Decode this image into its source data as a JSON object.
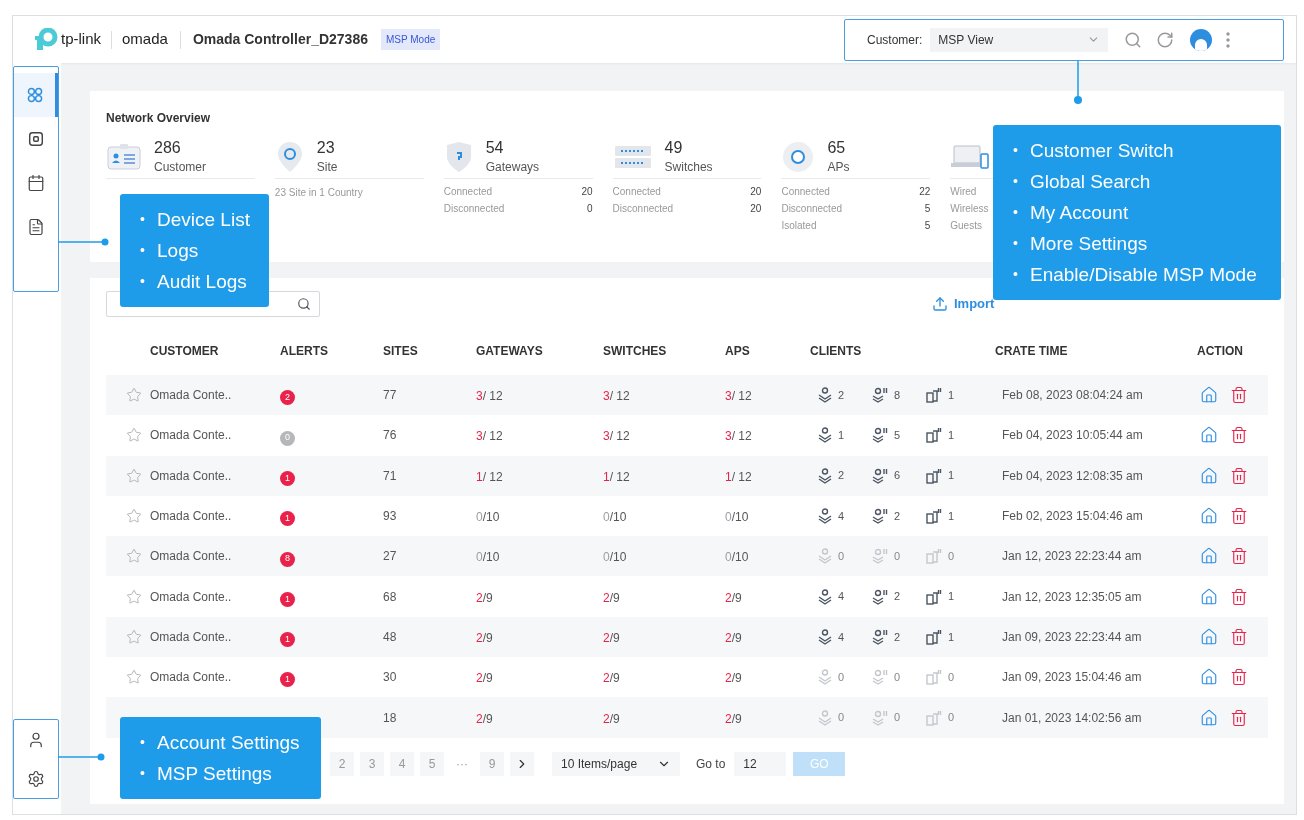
{
  "header": {
    "brand": "tp-link",
    "product": "omada",
    "title": "Omada Controller_D27386",
    "badge": "MSP Mode",
    "customer_label": "Customer:",
    "customer_value": "MSP View"
  },
  "sidebar": {
    "top": [
      {
        "kind": "grid",
        "selected": true
      },
      {
        "kind": "device",
        "selected": false
      },
      {
        "kind": "logs",
        "selected": false
      },
      {
        "kind": "audit",
        "selected": false
      }
    ],
    "bottom": [
      {
        "kind": "account"
      },
      {
        "kind": "settings"
      }
    ]
  },
  "overview": {
    "title": "Network Overview",
    "stats": [
      {
        "kind": "customer",
        "number": "286",
        "label": "Customer"
      },
      {
        "kind": "site",
        "number": "23",
        "label": "Site",
        "note": "23 Site in 1 Country"
      },
      {
        "kind": "gateway",
        "number": "54",
        "label": "Gateways",
        "details": [
          {
            "label": "Connected",
            "value": "20"
          },
          {
            "label": "Disconnected",
            "value": "0"
          }
        ]
      },
      {
        "kind": "switch",
        "number": "49",
        "label": "Switches",
        "details": [
          {
            "label": "Connected",
            "value": "20"
          },
          {
            "label": "Disconnected",
            "value": "20"
          }
        ]
      },
      {
        "kind": "ap",
        "number": "65",
        "label": "APs",
        "details": [
          {
            "label": "Connected",
            "value": "22"
          },
          {
            "label": "Disconnected",
            "value": "5"
          },
          {
            "label": "Isolated",
            "value": "5"
          }
        ]
      },
      {
        "kind": "client",
        "details": [
          {
            "label": "Wired"
          },
          {
            "label": "Wireless"
          },
          {
            "label": "Guests"
          }
        ]
      }
    ]
  },
  "table": {
    "import_label": "Import",
    "columns": [
      "CUSTOMER",
      "ALERTS",
      "SITES",
      "GATEWAYS",
      "SWITCHES",
      "APS",
      "CLIENTS",
      "CRATE TIME",
      "ACTION"
    ],
    "rows": [
      {
        "customer": "Omada Conte..",
        "alerts": {
          "count": "2",
          "color": "#e8224a"
        },
        "sites": "77",
        "gateways": {
          "count": "3",
          "rest": "/ 12",
          "alert": true
        },
        "switches": {
          "count": "3",
          "rest": "/ 12",
          "alert": true
        },
        "aps": {
          "count": "3",
          "rest": "/ 12",
          "alert": true
        },
        "clients": {
          "wired": "2",
          "wireless": "8",
          "guests": "1",
          "active": true
        },
        "created": "Feb 08, 2023 08:04:24 am"
      },
      {
        "customer": "Omada Conte..",
        "alerts": {
          "count": "0",
          "color": "#b5b7bb"
        },
        "sites": "76",
        "gateways": {
          "count": "3",
          "rest": "/ 12",
          "alert": true
        },
        "switches": {
          "count": "3",
          "rest": "/ 12",
          "alert": true
        },
        "aps": {
          "count": "3",
          "rest": "/ 12",
          "alert": true
        },
        "clients": {
          "wired": "1",
          "wireless": "5",
          "guests": "1",
          "active": true
        },
        "created": "Feb 04, 2023 10:05:44 am"
      },
      {
        "customer": "Omada Conte..",
        "alerts": {
          "count": "1",
          "color": "#e8224a"
        },
        "sites": "71",
        "gateways": {
          "count": "1",
          "rest": "/ 12",
          "alert": true
        },
        "switches": {
          "count": "1",
          "rest": "/ 12",
          "alert": true
        },
        "aps": {
          "count": "1",
          "rest": "/ 12",
          "alert": true
        },
        "clients": {
          "wired": "2",
          "wireless": "6",
          "guests": "1",
          "active": true
        },
        "created": "Feb 04, 2023 12:08:35 am"
      },
      {
        "customer": "Omada Conte..",
        "alerts": {
          "count": "1",
          "color": "#e8224a"
        },
        "sites": "93",
        "gateways": {
          "count": "0",
          "rest": "/10",
          "alert": false
        },
        "switches": {
          "count": "0",
          "rest": "/10",
          "alert": false
        },
        "aps": {
          "count": "0",
          "rest": "/10",
          "alert": false
        },
        "clients": {
          "wired": "4",
          "wireless": "2",
          "guests": "1",
          "active": true
        },
        "created": "Feb 02, 2023 15:04:46 am"
      },
      {
        "customer": "Omada Conte..",
        "alerts": {
          "count": "8",
          "color": "#e8224a"
        },
        "sites": "27",
        "gateways": {
          "count": "0",
          "rest": "/10",
          "alert": false
        },
        "switches": {
          "count": "0",
          "rest": "/10",
          "alert": false
        },
        "aps": {
          "count": "0",
          "rest": "/10",
          "alert": false
        },
        "clients": {
          "wired": "0",
          "wireless": "0",
          "guests": "0",
          "active": false
        },
        "created": "Jan 12, 2023 22:23:44 am"
      },
      {
        "customer": "Omada Conte..",
        "alerts": {
          "count": "1",
          "color": "#e8224a"
        },
        "sites": "68",
        "gateways": {
          "count": "2",
          "rest": "/9",
          "alert": true
        },
        "switches": {
          "count": "2",
          "rest": "/9",
          "alert": true
        },
        "aps": {
          "count": "2",
          "rest": "/9",
          "alert": true
        },
        "clients": {
          "wired": "4",
          "wireless": "2",
          "guests": "1",
          "active": true
        },
        "created": "Jan 12, 2023 12:35:05 am"
      },
      {
        "customer": "Omada Conte..",
        "alerts": {
          "count": "1",
          "color": "#e8224a"
        },
        "sites": "48",
        "gateways": {
          "count": "2",
          "rest": "/9",
          "alert": true
        },
        "switches": {
          "count": "2",
          "rest": "/9",
          "alert": true
        },
        "aps": {
          "count": "2",
          "rest": "/9",
          "alert": true
        },
        "clients": {
          "wired": "4",
          "wireless": "2",
          "guests": "1",
          "active": true
        },
        "created": "Jan 09, 2023 22:23:44 am"
      },
      {
        "customer": "Omada Conte..",
        "alerts": {
          "count": "1",
          "color": "#e8224a"
        },
        "sites": "30",
        "gateways": {
          "count": "2",
          "rest": "/9",
          "alert": true
        },
        "switches": {
          "count": "2",
          "rest": "/9",
          "alert": true
        },
        "aps": {
          "count": "2",
          "rest": "/9",
          "alert": true
        },
        "clients": {
          "wired": "0",
          "wireless": "0",
          "guests": "0",
          "active": false
        },
        "created": "Jan 09, 2023 15:04:46 am"
      },
      {
        "sites": "18",
        "gateways": {
          "count": "2",
          "rest": "/9",
          "alert": true
        },
        "switches": {
          "count": "2",
          "rest": "/9",
          "alert": true
        },
        "aps": {
          "count": "2",
          "rest": "/9",
          "alert": true
        },
        "clients": {
          "wired": "0",
          "wireless": "0",
          "guests": "0",
          "active": false
        },
        "created": "Jan 01, 2023 14:02:56 am"
      }
    ]
  },
  "pagination": {
    "pages": [
      {
        "label": "2",
        "kind": "page"
      },
      {
        "label": "3",
        "kind": "page"
      },
      {
        "label": "4",
        "kind": "page"
      },
      {
        "label": "5",
        "kind": "page"
      },
      {
        "label": "···",
        "kind": "gap"
      },
      {
        "label": "9",
        "kind": "page"
      }
    ],
    "per_page": "10 Items/page",
    "goto_label": "Go to",
    "goto_value": "12",
    "go_label": "GO",
    "go_disabled": true
  },
  "callouts": [
    {
      "kind": "sidebar",
      "marker": "•",
      "items": [
        "Device List",
        "Logs",
        "Audit Logs"
      ]
    },
    {
      "kind": "topbar",
      "marker": "•",
      "items": [
        "Customer Switch",
        "Global Search",
        "My Account",
        "More Settings",
        "Enable/Disable MSP Mode"
      ]
    },
    {
      "kind": "bottom",
      "marker": "•",
      "items": [
        "Account Settings",
        "MSP Settings"
      ]
    }
  ]
}
